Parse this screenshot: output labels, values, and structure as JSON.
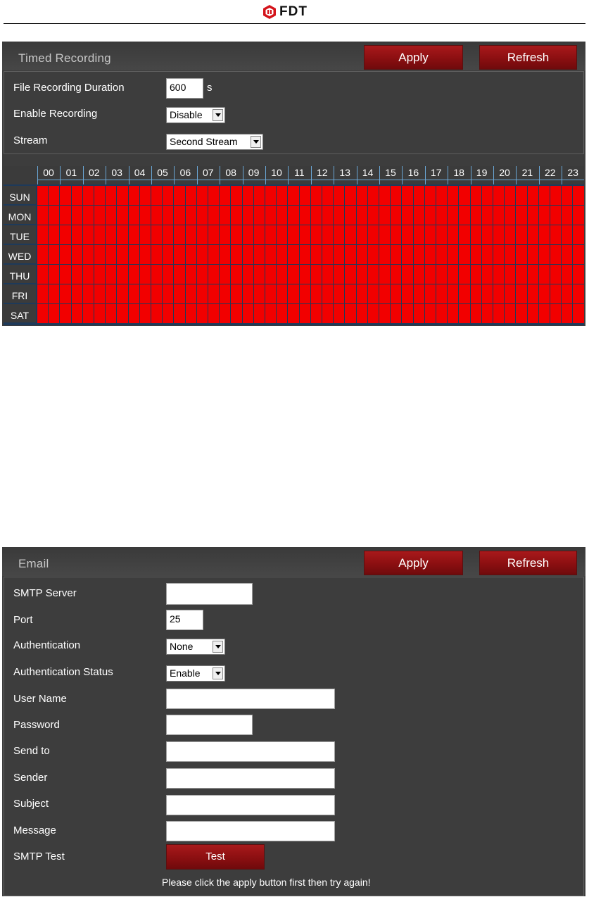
{
  "brand": {
    "name": "FDT"
  },
  "timed_recording": {
    "title": "Timed Recording",
    "apply_label": "Apply",
    "refresh_label": "Refresh",
    "fields": {
      "file_duration": {
        "label": "File Recording Duration",
        "value": "600",
        "unit": "s"
      },
      "enable_recording": {
        "label": "Enable Recording",
        "value": "Disable"
      },
      "stream": {
        "label": "Stream",
        "value": "Second Stream"
      }
    },
    "schedule": {
      "hours": [
        "00",
        "01",
        "02",
        "03",
        "04",
        "05",
        "06",
        "07",
        "08",
        "09",
        "10",
        "11",
        "12",
        "13",
        "14",
        "15",
        "16",
        "17",
        "18",
        "19",
        "20",
        "21",
        "22",
        "23"
      ],
      "days": [
        "SUN",
        "MON",
        "TUE",
        "WED",
        "THU",
        "FRI",
        "SAT"
      ],
      "active_color": "#f20000",
      "all_slots_active": true
    }
  },
  "email": {
    "title": "Email",
    "apply_label": "Apply",
    "refresh_label": "Refresh",
    "fields": {
      "smtp_server": {
        "label": "SMTP Server",
        "value": ""
      },
      "port": {
        "label": "Port",
        "value": "25"
      },
      "authentication": {
        "label": "Authentication",
        "value": "None"
      },
      "auth_status": {
        "label": "Authentication Status",
        "value": "Enable"
      },
      "user_name": {
        "label": "User Name",
        "value": ""
      },
      "password": {
        "label": "Password",
        "value": ""
      },
      "send_to": {
        "label": "Send to",
        "value": ""
      },
      "sender": {
        "label": "Sender",
        "value": ""
      },
      "subject": {
        "label": "Subject",
        "value": ""
      },
      "message": {
        "label": "Message",
        "value": ""
      },
      "smtp_test": {
        "label": "SMTP Test",
        "button_label": "Test"
      }
    },
    "notice": "Please click the apply button first then try again!"
  },
  "colors": {
    "panel_bg": "#3d3d3d",
    "button_red": "#8b0f11",
    "grid_line": "#1e3a5a",
    "text": "#ffffff"
  }
}
